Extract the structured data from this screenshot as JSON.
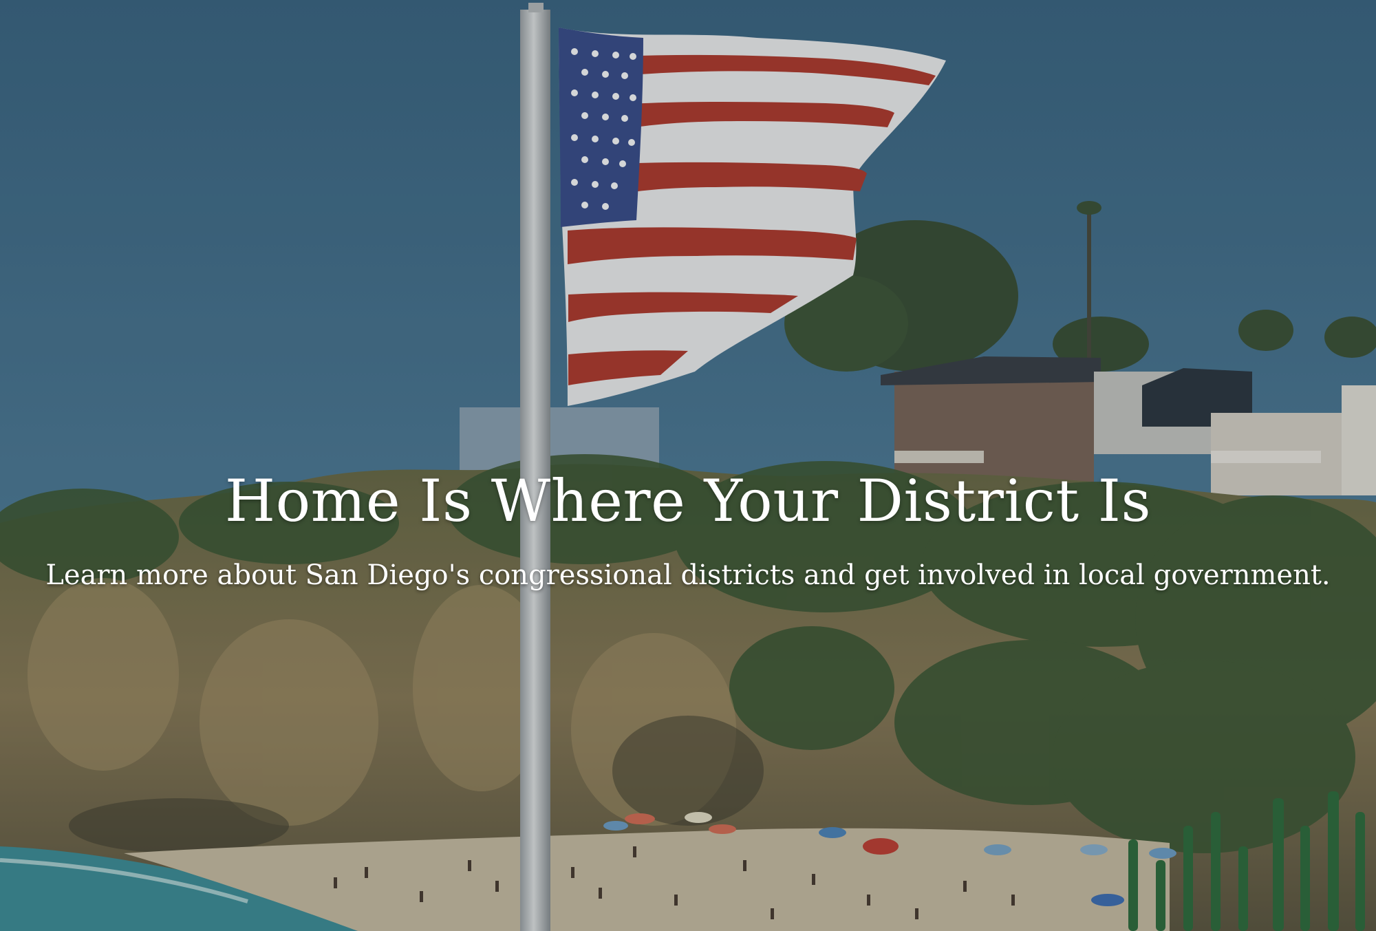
{
  "hero": {
    "title": "Home Is Where Your District Is",
    "subtitle": "Learn more about San Diego's congressional districts and get involved in local government."
  },
  "colors": {
    "sky": "#3f6c89",
    "sky_horizon": "#5d8aa6",
    "cliff": "#8a7b55",
    "foliage": "#3e5a33",
    "sand": "#cfc3a8",
    "ocean": "#3f8f99",
    "flag_red": "#b23a2c",
    "flag_white": "#f2f2f2",
    "flag_blue": "#3a4e8c",
    "text": "#ffffff"
  }
}
